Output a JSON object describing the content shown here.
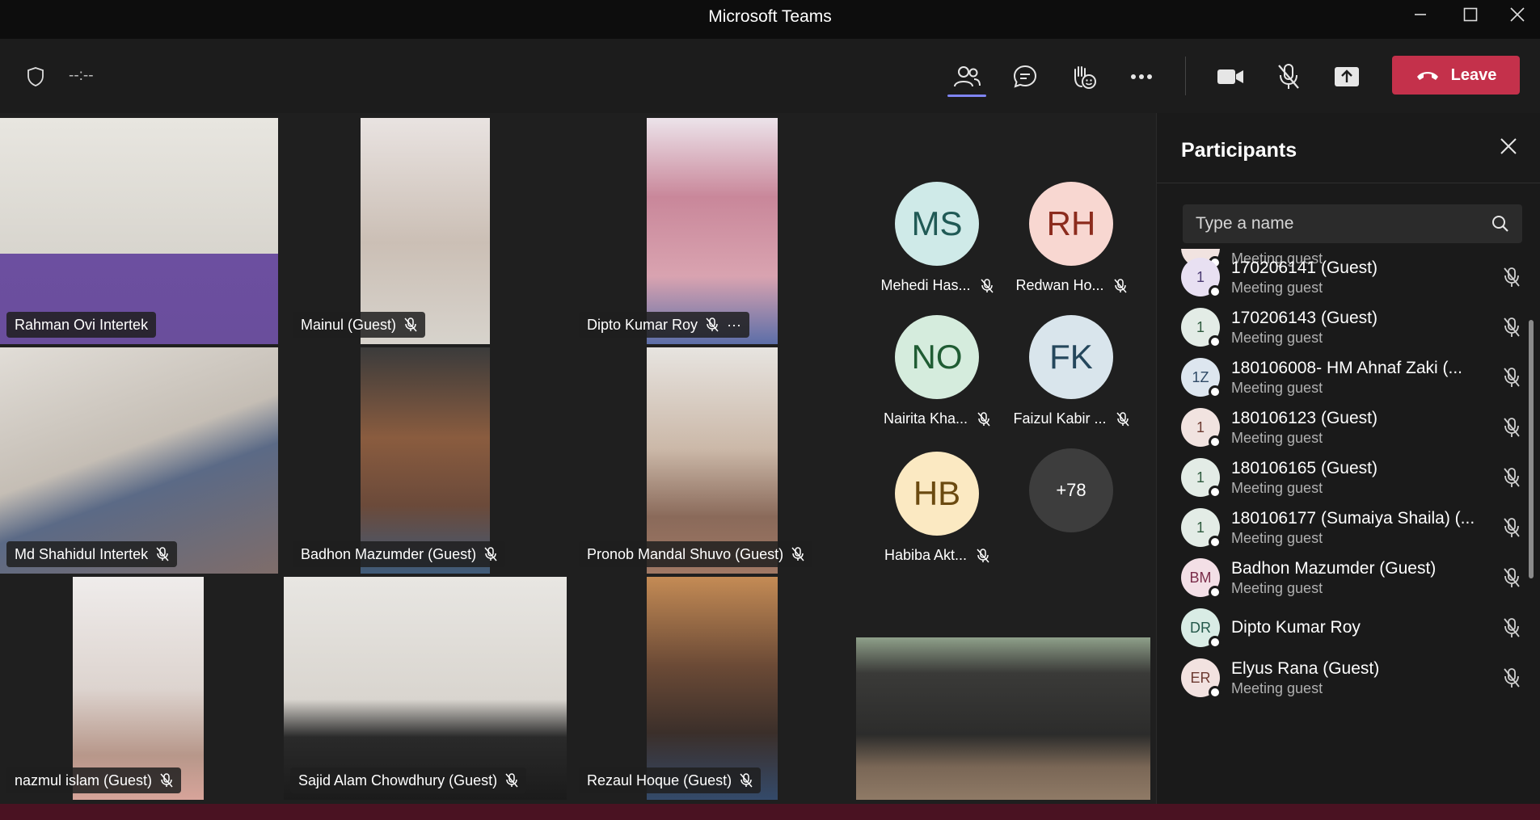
{
  "window": {
    "title": "Microsoft Teams"
  },
  "toolbar": {
    "timer": "--:--",
    "leave_label": "Leave",
    "icons": [
      "shield-icon",
      "people-icon",
      "chat-icon",
      "reactions-icon",
      "more-icon",
      "camera-icon",
      "mic-off-icon",
      "share-icon",
      "phone-icon"
    ]
  },
  "tiles": [
    {
      "name": "Rahman Ovi Intertek",
      "muted": false,
      "active": true
    },
    {
      "name": "Mainul (Guest)",
      "muted": true
    },
    {
      "name": "Dipto Kumar Roy",
      "muted": true,
      "more": "···"
    },
    {
      "name": "Md Shahidul Intertek",
      "muted": true
    },
    {
      "name": "Badhon Mazumder (Guest)",
      "muted": true
    },
    {
      "name": "Pronob Mandal Shuvo (Guest)",
      "muted": true
    },
    {
      "name": "nazmul islam (Guest)",
      "muted": true
    },
    {
      "name": "Sajid Alam Chowdhury (Guest)",
      "muted": true
    },
    {
      "name": "Rezaul Hoque (Guest)",
      "muted": true
    }
  ],
  "avatars": [
    {
      "initials": "MS",
      "name": "Mehedi Has...",
      "color": "#cfeae8",
      "text": "#205a55"
    },
    {
      "initials": "RH",
      "name": "Redwan Ho...",
      "color": "#f8d7d1",
      "text": "#8c2b1d"
    },
    {
      "initials": "NO",
      "name": "Nairita Kha...",
      "color": "#d5ecdd",
      "text": "#1f5c33"
    },
    {
      "initials": "FK",
      "name": "Faizul Kabir ...",
      "color": "#d9e5ec",
      "text": "#25475c"
    },
    {
      "initials": "HB",
      "name": "Habiba Akt...",
      "color": "#fbe9c2",
      "text": "#6b4a10"
    },
    {
      "initials": "+78",
      "name": "",
      "color": "#3d3d3d",
      "text": "#ffffff"
    }
  ],
  "panel": {
    "title": "Participants",
    "search_placeholder": "Type a name",
    "partial_role": "Meeting guest",
    "participants": [
      {
        "initials": "1",
        "name": "170206141 (Guest)",
        "role": "Meeting guest",
        "color": "#e8e0f2",
        "text": "#4b3a72"
      },
      {
        "initials": "1",
        "name": "170206143 (Guest)",
        "role": "Meeting guest",
        "color": "#e3ece6",
        "text": "#2e5a3d"
      },
      {
        "initials": "1Z",
        "name": "180106008- HM Ahnaf Zaki (...",
        "role": "Meeting guest",
        "color": "#dde6ef",
        "text": "#2f4a66"
      },
      {
        "initials": "1",
        "name": "180106123 (Guest)",
        "role": "Meeting guest",
        "color": "#f1e3e0",
        "text": "#6c3a30"
      },
      {
        "initials": "1",
        "name": "180106165 (Guest)",
        "role": "Meeting guest",
        "color": "#e3ece6",
        "text": "#2e5a3d"
      },
      {
        "initials": "1",
        "name": "180106177 (Sumaiya Shaila) (...",
        "role": "Meeting guest",
        "color": "#e3ece6",
        "text": "#2e5a3d"
      },
      {
        "initials": "BM",
        "name": "Badhon Mazumder (Guest)",
        "role": "Meeting guest",
        "color": "#f3dfe6",
        "text": "#7a2d4a"
      },
      {
        "initials": "DR",
        "name": "Dipto Kumar Roy",
        "role": "",
        "color": "#d9ece5",
        "text": "#24584a"
      },
      {
        "initials": "ER",
        "name": "Elyus Rana (Guest)",
        "role": "Meeting guest",
        "color": "#f2e2e0",
        "text": "#6c3a30"
      }
    ]
  }
}
